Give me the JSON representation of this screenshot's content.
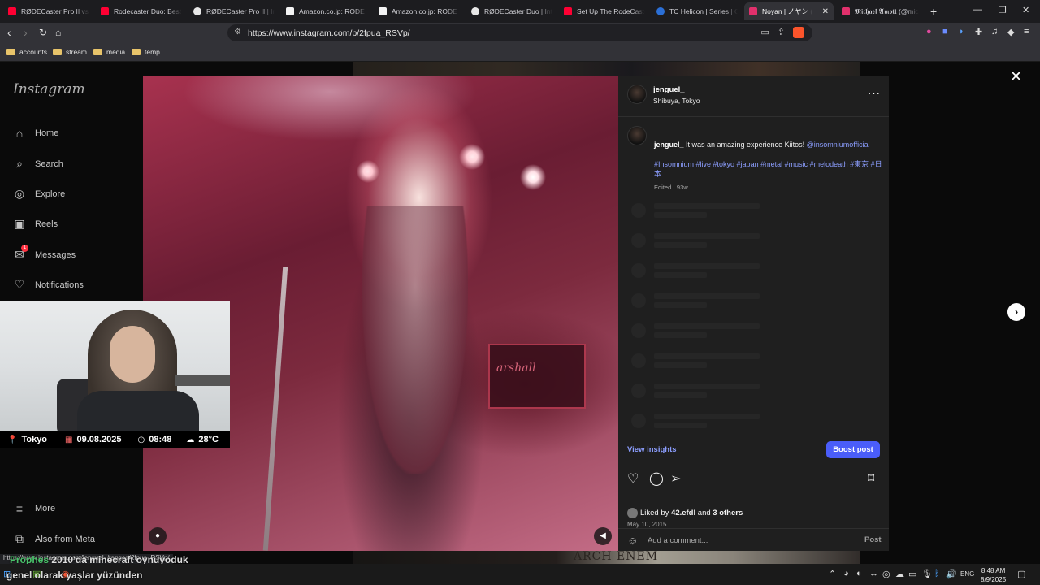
{
  "browser": {
    "tabs": [
      {
        "label": "RØDECaster Pro II vs R",
        "color": "#ff0033"
      },
      {
        "label": "Rodecaster Duo: Best I",
        "color": "#ff0033"
      },
      {
        "label": "RØDECaster Pro II | Int",
        "color": "#f0f0f0"
      },
      {
        "label": "Amazon.co.jp: RODE M",
        "color": "#f3f3f3"
      },
      {
        "label": "Amazon.co.jp: RODE M",
        "color": "#f3f3f3"
      },
      {
        "label": "RØDECaster Duo | Inte",
        "color": "#f0f0f0"
      },
      {
        "label": "Set Up The RodeCaster",
        "color": "#ff0033"
      },
      {
        "label": "TC Helicon | Series | Go",
        "color": "#2b6fd6"
      },
      {
        "label": "Noyan | ノヤン (@",
        "color": "#e1306c"
      },
      {
        "label": "𝕸𝖎𝖈𝖍𝖆𝖊𝖑 𝕬𝖒𝖔𝖙𝖙 (@mic",
        "color": "#e1306c"
      }
    ],
    "url": "https://www.instagram.com/p/2fpua_RSVp/",
    "bookmarks": [
      "accounts",
      "stream",
      "media",
      "temp"
    ],
    "status_url": "https://www.instagram.com/jenguel_/tagged/2fpua_RSVp/"
  },
  "instagram": {
    "logo": "Instagram",
    "nav": [
      {
        "label": "Home",
        "icon": "⌂"
      },
      {
        "label": "Search",
        "icon": "⌕"
      },
      {
        "label": "Explore",
        "icon": "◎"
      },
      {
        "label": "Reels",
        "icon": "▣"
      },
      {
        "label": "Messages",
        "icon": "✉"
      },
      {
        "label": "Notifications",
        "icon": "♡"
      }
    ],
    "messages_badge": "1",
    "more": "More",
    "also_from_meta": "Also from Meta",
    "background_text": "ARCH ENEM"
  },
  "post": {
    "username": "jenguel_",
    "location": "Shibuya, Tokyo",
    "more": "···",
    "caption_user": "jenguel_",
    "caption_text": " It was an amazing experience Kiitos! ",
    "caption_mention": "@insomniumofficial",
    "hashtags": "#Insomnium #live #tokyo #japan #metal #music #melodeath #東京 #日本",
    "edited": "Edited · 93w",
    "amp_brand": "arshall",
    "view_insights": "View insights",
    "boost": "Boost post",
    "liked_prefix": "Liked by ",
    "liked_user": "42.efdl",
    "liked_and": " and ",
    "liked_others": "3 others",
    "date": "May 10, 2015",
    "comment_placeholder": "Add a comment...",
    "post_label": "Post"
  },
  "webcam": {
    "location": "Tokyo",
    "date": "09.08.2025",
    "time": "08:48",
    "temperature": "28°C"
  },
  "chat": {
    "line1_user": "Prophes",
    "line1_text": "2010'da minecraft oynuyoduk",
    "line2_user": "genel olarak",
    "line2_text": "yaşlar yüzünden"
  },
  "taskbar": {
    "lang": "ENG",
    "time": "8:48 AM",
    "date": "8/9/2025"
  }
}
